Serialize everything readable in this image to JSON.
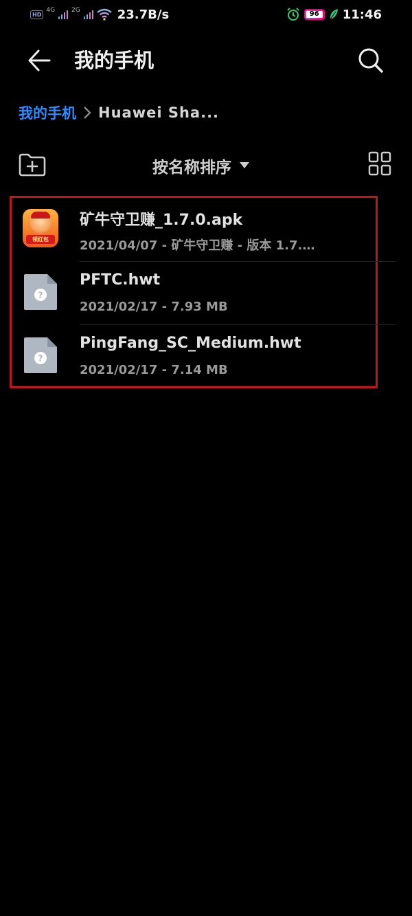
{
  "status_bar": {
    "hd": "HD",
    "net1": "4G",
    "net2": "2G",
    "speed": "23.7B/s",
    "battery": "96",
    "time": "11:46"
  },
  "header": {
    "title": "我的手机",
    "back_icon": "arrow-left-icon",
    "search_icon": "search-icon"
  },
  "breadcrumb": {
    "root": "我的手机",
    "current": "Huawei Sha..."
  },
  "toolbar": {
    "sort_label": "按名称排序",
    "new_folder_icon": "folder-plus-icon",
    "view_icon": "grid-view-icon"
  },
  "files": [
    {
      "name": "矿牛守卫赚_1.7.0.apk",
      "meta": "2021/04/07 - 矿牛守卫赚 - 版本 1.7.…",
      "icon": "app-icon",
      "badge": "领红包"
    },
    {
      "name": "PFTC.hwt",
      "meta": "2021/02/17 - 7.93 MB",
      "icon": "unknown-file-icon"
    },
    {
      "name": "PingFang_SC_Medium.hwt",
      "meta": "2021/02/17 - 7.14 MB",
      "icon": "unknown-file-icon"
    }
  ],
  "colors": {
    "background": "#000000",
    "accent": "#2f8cff",
    "highlight_border": "#c0161b"
  }
}
